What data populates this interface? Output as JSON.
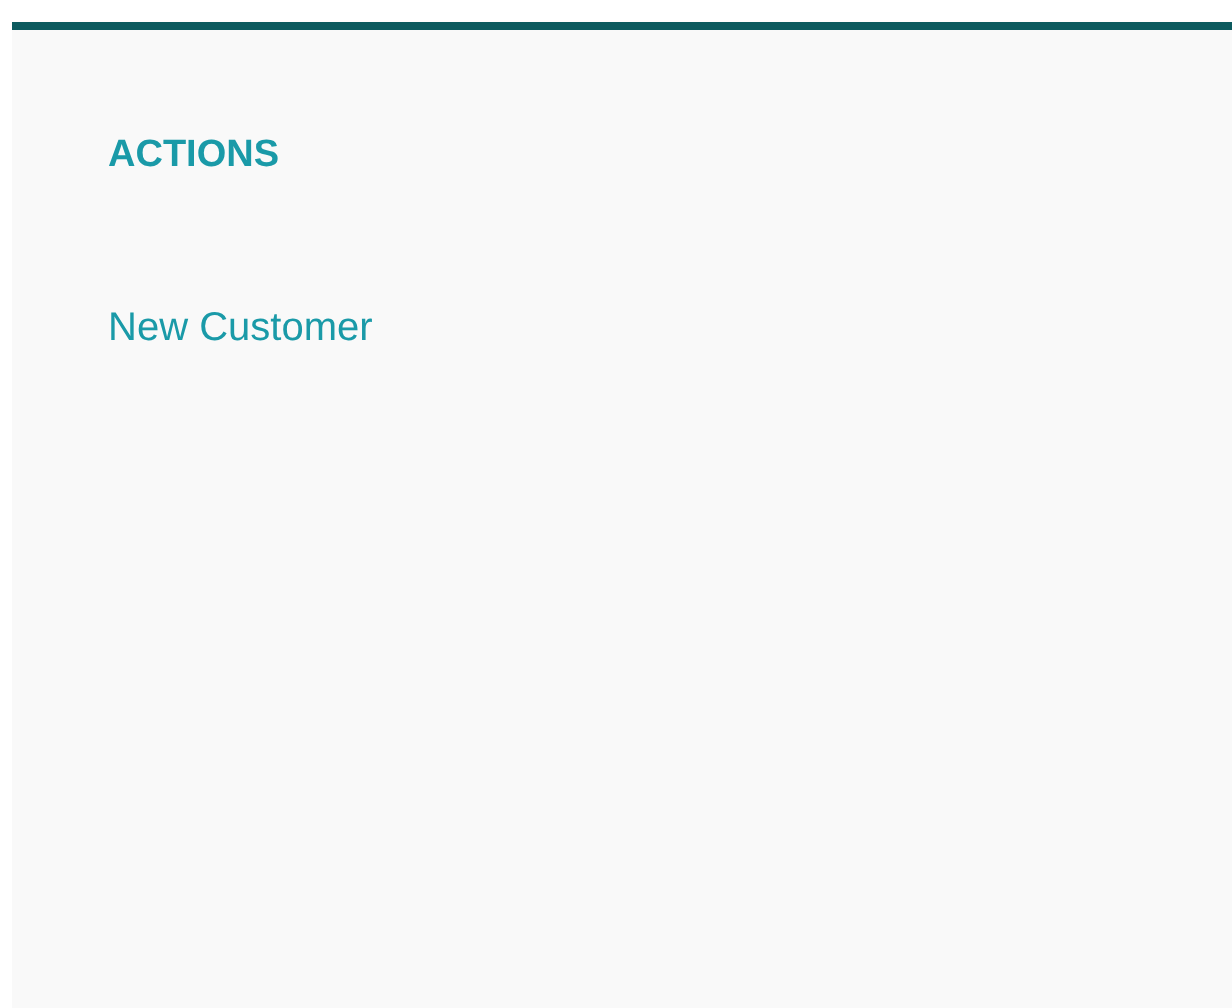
{
  "panel": {
    "heading": "ACTIONS",
    "links": [
      "New Customer"
    ]
  }
}
